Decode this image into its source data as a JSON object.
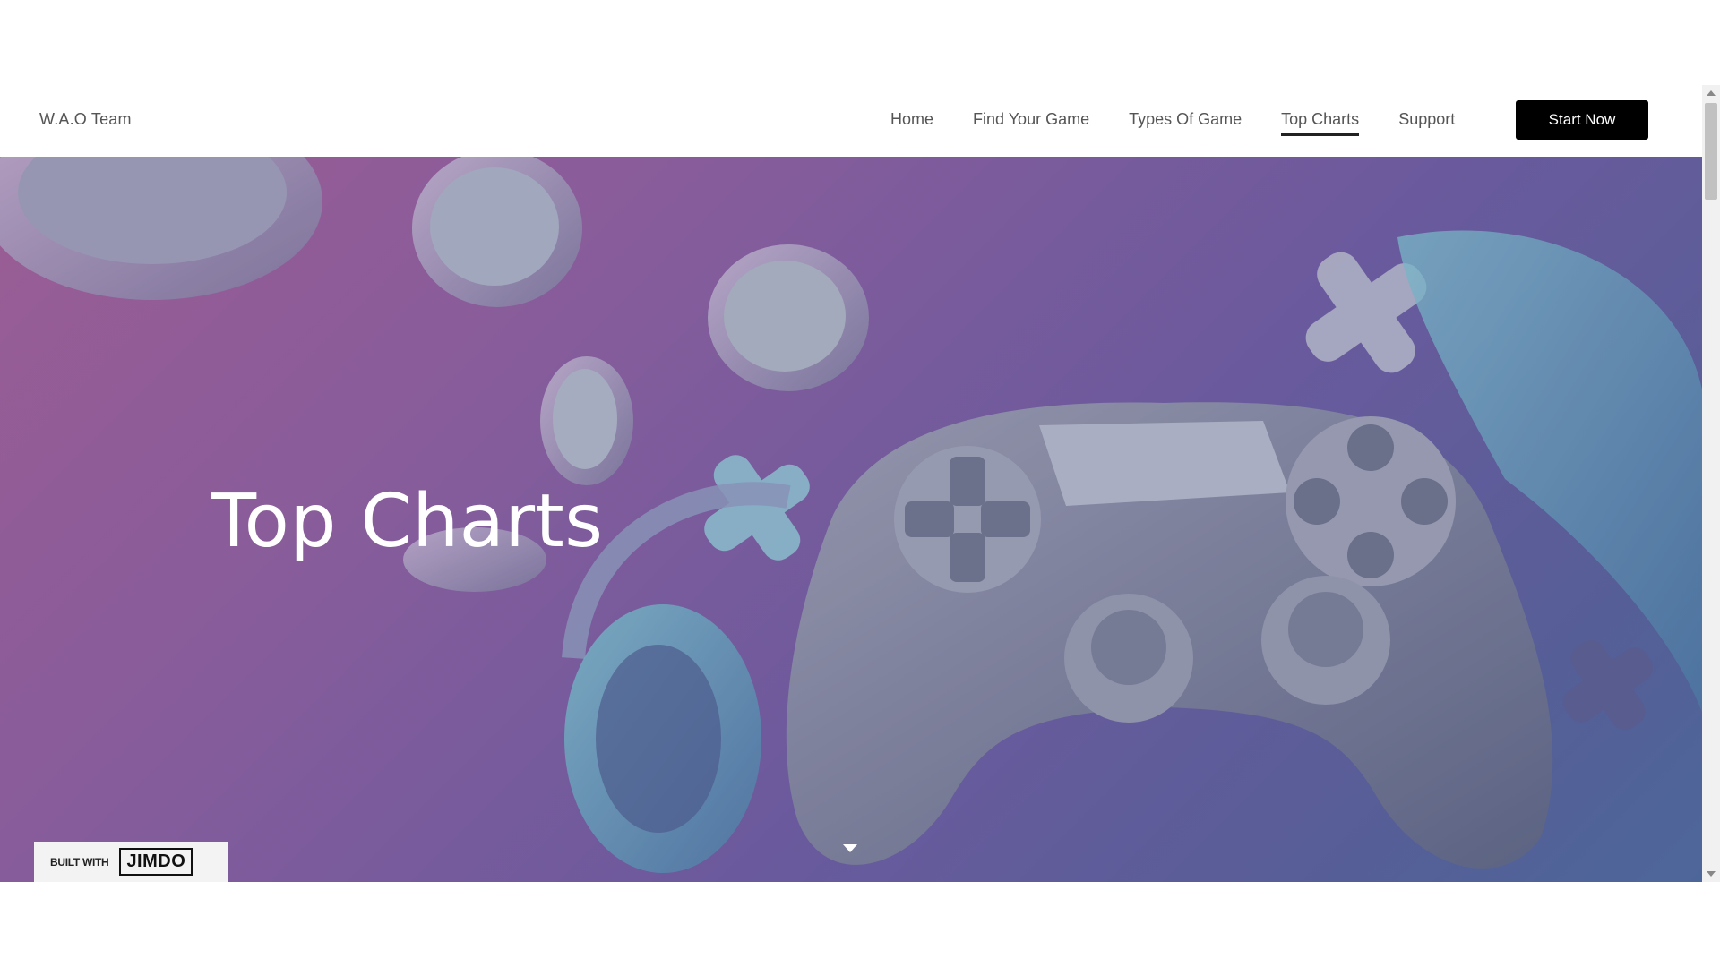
{
  "header": {
    "logo": "W.A.O Team",
    "nav": [
      {
        "label": "Home",
        "active": false
      },
      {
        "label": "Find Your Game",
        "active": false
      },
      {
        "label": "Types Of Game",
        "active": false
      },
      {
        "label": "Top Charts",
        "active": true
      },
      {
        "label": "Support",
        "active": false
      }
    ],
    "cta_label": "Start Now"
  },
  "hero": {
    "title": "Top Charts",
    "background_image": "gaming-controller-headphones-icon"
  },
  "badge": {
    "built_with": "BUILT WITH",
    "brand": "JIMDO"
  },
  "colors": {
    "cta_background": "#000000",
    "hero_gradient_start": "#93508c",
    "hero_gradient_end": "#3e5a92"
  }
}
